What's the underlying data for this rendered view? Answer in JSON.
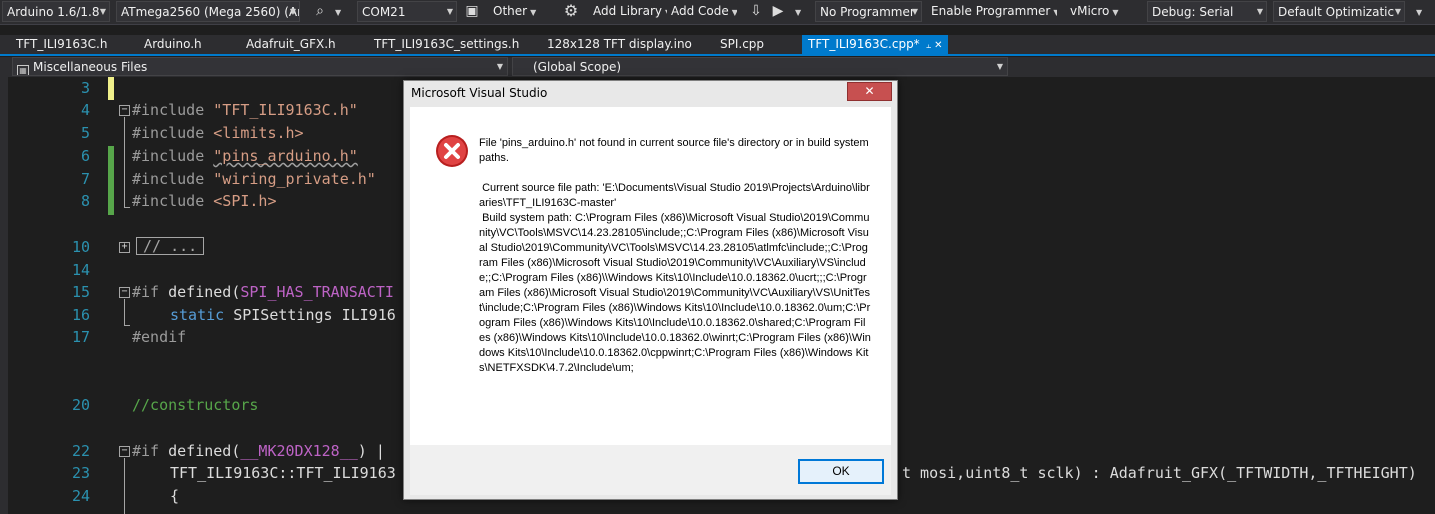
{
  "toolbar": {
    "board": "Arduino 1.6/1.8",
    "mcu": "ATmega2560 (Mega 2560) (Arc",
    "port": "COM21",
    "other": "Other",
    "add_library": "Add Library",
    "add_code": "Add Code",
    "programmer": "No Programmer",
    "enable_programmer": "Enable Programmer",
    "vmicro": "vMicro",
    "debug": "Debug: Serial",
    "optimization": "Default Optimizatic"
  },
  "tabs": [
    {
      "label": "TFT_ILI9163C.h"
    },
    {
      "label": "Arduino.h"
    },
    {
      "label": "Adafruit_GFX.h"
    },
    {
      "label": "TFT_ILI9163C_settings.h"
    },
    {
      "label": "128x128 TFT display.ino"
    },
    {
      "label": "SPI.cpp"
    },
    {
      "label": "TFT_ILI9163C.cpp*"
    }
  ],
  "navbar": {
    "project": "Miscellaneous Files",
    "scope": "(Global Scope)"
  },
  "code": {
    "l3": {
      "num": "3",
      "text": ""
    },
    "l4": {
      "num": "4",
      "kw": "#include ",
      "str": "\"TFT_ILI9163C.h\""
    },
    "l5": {
      "num": "5",
      "kw": "#include ",
      "str": "<limits.h>"
    },
    "l6": {
      "num": "6",
      "kw": "#include ",
      "str": "\"pins_arduino.h\""
    },
    "l7": {
      "num": "7",
      "kw": "#include ",
      "str": "\"wiring_private.h\""
    },
    "l8": {
      "num": "8",
      "kw": "#include ",
      "str": "<SPI.h>"
    },
    "l10": {
      "num": "10",
      "collapsed": "// ..."
    },
    "l14": {
      "num": "14"
    },
    "l15": {
      "num": "15",
      "kw": "#if ",
      "plain": "defined(",
      "macro": "SPI_HAS_TRANSACTI"
    },
    "l16": {
      "num": "16",
      "kw": "static ",
      "plain": "SPISettings ILI916"
    },
    "l17": {
      "num": "17",
      "kw": "#endif"
    },
    "l20": {
      "num": "20",
      "comment": "//constructors"
    },
    "l22": {
      "num": "22",
      "kw": "#if ",
      "plain": "defined(",
      "macro": "__MK20DX128__",
      "tail": ") |"
    },
    "l23": {
      "num": "23",
      "plain": "TFT_ILI9163C::TFT_ILI9163",
      "right": "t mosi,uint8_t sclk) : Adafruit_GFX(_TFTWIDTH,_TFTHEIGHT)"
    },
    "l24": {
      "num": "24",
      "plain": "{"
    }
  },
  "dialog": {
    "title": "Microsoft Visual Studio",
    "close_label": "✕",
    "message": "File 'pins_arduino.h' not found in current source file's directory or in build system paths.\n\n Current source file path: 'E:\\Documents\\Visual Studio 2019\\Projects\\Arduino\\libraries\\TFT_ILI9163C-master'\n Build system path: C:\\Program Files (x86)\\Microsoft Visual Studio\\2019\\Community\\VC\\Tools\\MSVC\\14.23.28105\\include;;C:\\Program Files (x86)\\Microsoft Visual Studio\\2019\\Community\\VC\\Tools\\MSVC\\14.23.28105\\atlmfc\\include;;C:\\Program Files (x86)\\Microsoft Visual Studio\\2019\\Community\\VC\\Auxiliary\\VS\\include;;C:\\Program Files (x86)\\\\Windows Kits\\10\\Include\\10.0.18362.0\\ucrt;;;C:\\Program Files (x86)\\Microsoft Visual Studio\\2019\\Community\\VC\\Auxiliary\\VS\\UnitTest\\include;C:\\Program Files (x86)\\Windows Kits\\10\\Include\\10.0.18362.0\\um;C:\\Program Files (x86)\\Windows Kits\\10\\Include\\10.0.18362.0\\shared;C:\\Program Files (x86)\\Windows Kits\\10\\Include\\10.0.18362.0\\winrt;C:\\Program Files (x86)\\Windows Kits\\10\\Include\\10.0.18362.0\\cppwinrt;C:\\Program Files (x86)\\Windows Kits\\NETFXSDK\\4.7.2\\Include\\um;",
    "ok_label": "OK",
    "icon": "error-icon"
  },
  "colors": {
    "editor_bg": "#1e1e1e",
    "keyword": "#569cd6",
    "string": "#d69d85",
    "comment": "#57a64a",
    "macro": "#bd63c5",
    "accent": "#007acc"
  }
}
